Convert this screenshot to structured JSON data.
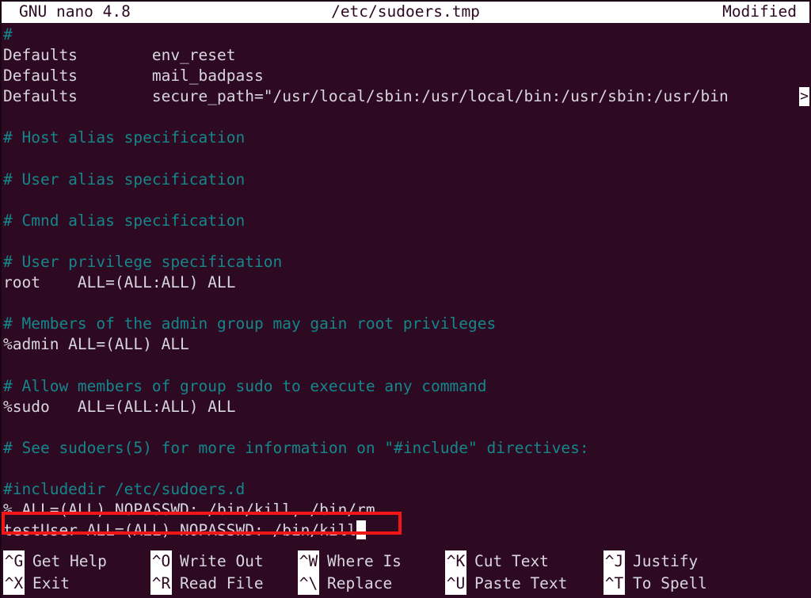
{
  "titlebar": {
    "program": "GNU nano 4.8",
    "filename": "/etc/sudoers.tmp",
    "status": "Modified"
  },
  "editor": {
    "continuation_marker": ">",
    "lines": [
      {
        "text": "#",
        "kind": "comment"
      },
      {
        "text": "Defaults        env_reset",
        "kind": "code"
      },
      {
        "text": "Defaults        mail_badpass",
        "kind": "code"
      },
      {
        "text": "Defaults        secure_path=\"/usr/local/sbin:/usr/local/bin:/usr/sbin:/usr/bin",
        "kind": "code",
        "truncated": true
      },
      {
        "text": "",
        "kind": "blank"
      },
      {
        "text": "# Host alias specification",
        "kind": "comment"
      },
      {
        "text": "",
        "kind": "blank"
      },
      {
        "text": "# User alias specification",
        "kind": "comment"
      },
      {
        "text": "",
        "kind": "blank"
      },
      {
        "text": "# Cmnd alias specification",
        "kind": "comment"
      },
      {
        "text": "",
        "kind": "blank"
      },
      {
        "text": "# User privilege specification",
        "kind": "comment"
      },
      {
        "text": "root    ALL=(ALL:ALL) ALL",
        "kind": "code"
      },
      {
        "text": "",
        "kind": "blank"
      },
      {
        "text": "# Members of the admin group may gain root privileges",
        "kind": "comment"
      },
      {
        "text": "%admin ALL=(ALL) ALL",
        "kind": "code"
      },
      {
        "text": "",
        "kind": "blank"
      },
      {
        "text": "# Allow members of group sudo to execute any command",
        "kind": "comment"
      },
      {
        "text": "%sudo   ALL=(ALL:ALL) ALL",
        "kind": "code"
      },
      {
        "text": "",
        "kind": "blank"
      },
      {
        "text": "# See sudoers(5) for more information on \"#include\" directives:",
        "kind": "comment"
      },
      {
        "text": "",
        "kind": "blank"
      },
      {
        "text": "#includedir /etc/sudoers.d",
        "kind": "comment"
      },
      {
        "text": "% ALL=(ALL) NOPASSWD: /bin/kill, /bin/rm",
        "kind": "code"
      },
      {
        "text": "testUser ALL=(ALL) NOPASSWD: /bin/kill",
        "kind": "code",
        "cursor_at_end": true
      }
    ]
  },
  "annotation": {
    "color": "#f31616",
    "target_line": "testUser ALL=(ALL) NOPASSWD: /bin/kill"
  },
  "helpbar": {
    "row1": [
      {
        "key": "^G",
        "label": "Get Help"
      },
      {
        "key": "^O",
        "label": "Write Out"
      },
      {
        "key": "^W",
        "label": "Where Is"
      },
      {
        "key": "^K",
        "label": "Cut Text"
      },
      {
        "key": "^J",
        "label": "Justify"
      }
    ],
    "row2": [
      {
        "key": "^X",
        "label": "Exit"
      },
      {
        "key": "^R",
        "label": "Read File"
      },
      {
        "key": "^\\",
        "label": "Replace"
      },
      {
        "key": "^U",
        "label": "Paste Text"
      },
      {
        "key": "^T",
        "label": "To Spell"
      }
    ]
  },
  "colors": {
    "background": "#2d0922",
    "foreground": "#d8d6e0",
    "comment": "#15878b",
    "titlebar_bg": "#ffffff",
    "titlebar_fg": "#2d0922",
    "annotation": "#f31616"
  }
}
